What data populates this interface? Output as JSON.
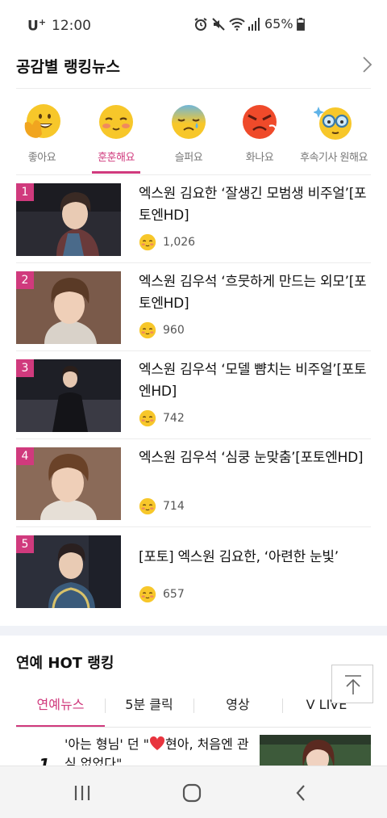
{
  "status_bar": {
    "carrier": "U",
    "carrier_sup": "+",
    "time": "12:00",
    "battery": "65%",
    "icons": [
      "alarm-icon",
      "mute-icon",
      "wifi-icon",
      "signal-icon",
      "battery-icon"
    ]
  },
  "section": {
    "title": "공감별 랭킹뉴스"
  },
  "emotion_tabs": [
    {
      "label": "좋아요",
      "icon": "thumbs-up-face-icon",
      "active": false
    },
    {
      "label": "훈훈해요",
      "icon": "blushing-face-icon",
      "active": true
    },
    {
      "label": "슬퍼요",
      "icon": "sad-face-icon",
      "active": false
    },
    {
      "label": "화나요",
      "icon": "angry-face-icon",
      "active": false
    },
    {
      "label": "후속기사 원해요",
      "icon": "glasses-face-icon",
      "active": false
    }
  ],
  "news": [
    {
      "rank": "1",
      "title": "엑스원 김요한 ‘잘생긴 모범생 비주얼’[포토엔HD]",
      "count": "1,026"
    },
    {
      "rank": "2",
      "title": "엑스원 김우석 ‘흐뭇하게 만드는 외모’[포토엔HD]",
      "count": "960"
    },
    {
      "rank": "3",
      "title": "엑스원 김우석 ‘모델 뺨치는 비주얼’[포토엔HD]",
      "count": "742"
    },
    {
      "rank": "4",
      "title": "엑스원 김우석 ‘심쿵 눈맞춤’[포토엔HD]",
      "count": "714"
    },
    {
      "rank": "5",
      "title": "[포토] 엑스원 김요한, ‘아련한 눈빛’",
      "count": "657"
    }
  ],
  "hot": {
    "title": "연예 HOT 랭킹",
    "tabs": [
      "연예뉴스",
      "5분 클릭",
      "영상",
      "V LIVE"
    ],
    "first_rank": "1",
    "first_title_a": "'아는 형님' 던 \"",
    "first_title_b": "현아, 처음엔 관심 없었다\""
  },
  "colors": {
    "accent": "#d03a7d",
    "band": "#f0f2f7"
  }
}
